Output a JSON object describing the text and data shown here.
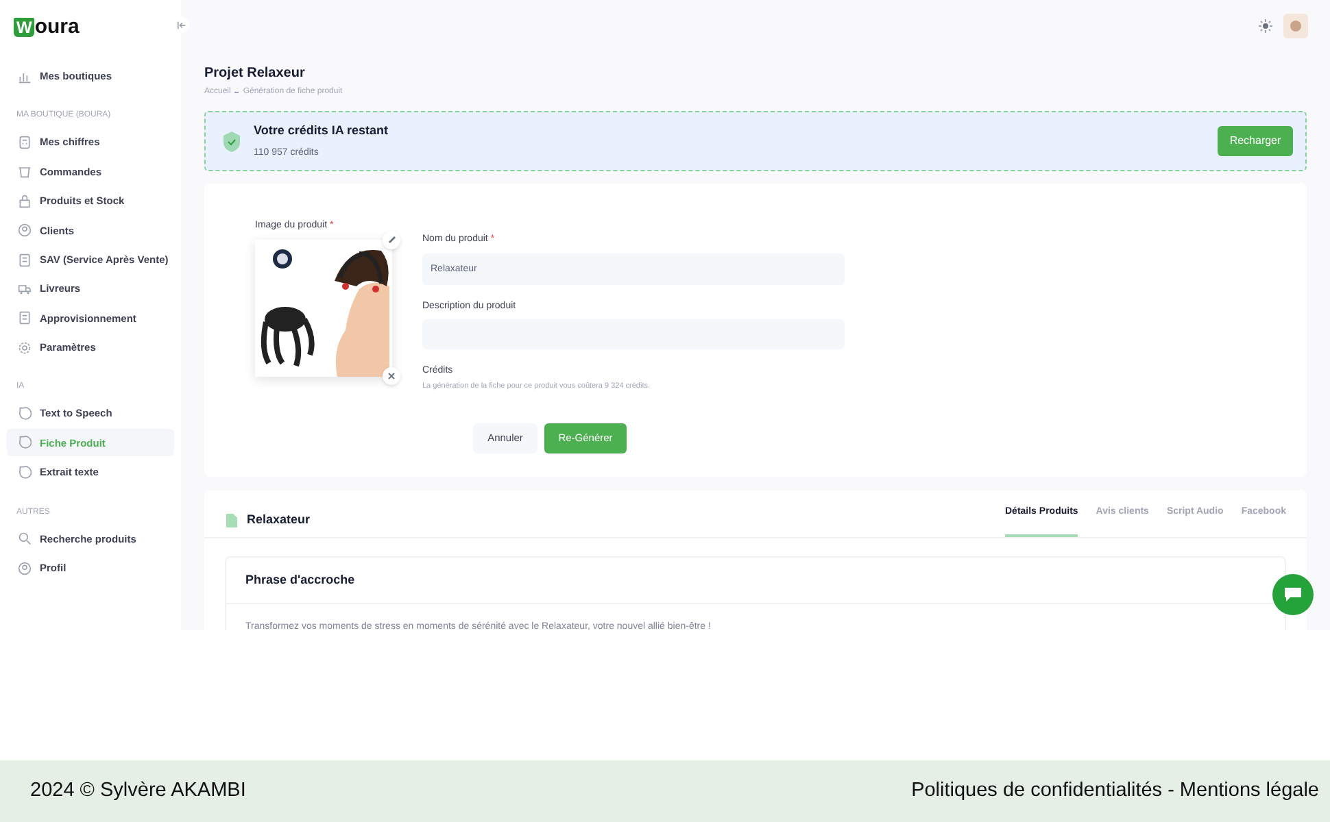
{
  "logo": {
    "initial": "W",
    "rest": "oura"
  },
  "sidebar": {
    "sections": [
      {
        "items": [
          {
            "label": "Mes boutiques",
            "selected": false
          }
        ]
      },
      {
        "heading": "MA BOUTIQUE (BOURA)",
        "items": [
          {
            "label": "Mes chiffres",
            "selected": false
          },
          {
            "label": "Commandes",
            "selected": false
          },
          {
            "label": "Produits et Stock",
            "selected": false
          },
          {
            "label": "Clients",
            "selected": false
          },
          {
            "label": "SAV (Service Après Vente)",
            "selected": false
          },
          {
            "label": "Livreurs",
            "selected": false
          },
          {
            "label": "Approvisionnement",
            "selected": false
          },
          {
            "label": "Paramètres",
            "selected": false
          }
        ]
      },
      {
        "heading": "IA",
        "items": [
          {
            "label": "Text to Speech",
            "selected": false
          },
          {
            "label": "Fiche Produit",
            "selected": true
          },
          {
            "label": "Extrait texte",
            "selected": false
          }
        ]
      },
      {
        "heading": "AUTRES",
        "items": [
          {
            "label": "Recherche produits",
            "selected": false
          },
          {
            "label": "Profil",
            "selected": false
          }
        ]
      }
    ]
  },
  "page": {
    "title": "Projet Relaxeur",
    "breadcrumb": [
      "Accueil",
      "Génération de fiche produit"
    ]
  },
  "credits_banner": {
    "title": "Votre crédits IA restant",
    "amount": "110 957 crédits",
    "button": "Recharger"
  },
  "form": {
    "image_label": "Image du produit",
    "image_required_mark": "*",
    "name_label": "Nom du produit",
    "name_required_mark": "*",
    "name_value": "Relaxateur",
    "description_label": "Description du produit",
    "credits_label": "Crédits",
    "credits_note": "La génération de la fiche pour ce produit vous coûtera 9 324 crédits.",
    "cancel": "Annuler",
    "submit": "Re-Générer"
  },
  "result": {
    "title": "Relaxateur",
    "tabs": [
      {
        "label": "Détails Produits",
        "selected": true
      },
      {
        "label": "Avis clients",
        "selected": false
      },
      {
        "label": "Script Audio",
        "selected": false
      },
      {
        "label": "Facebook",
        "selected": false
      }
    ],
    "section_title": "Phrase d'accroche",
    "section_text": "Transformez vos moments de stress en moments de sérénité avec le Relaxateur, votre nouvel allié bien-être !"
  },
  "footer": {
    "copyright": "2024 © Sylvère AKAMBI",
    "links": "Politiques de confidentialités - Mentions légale"
  }
}
